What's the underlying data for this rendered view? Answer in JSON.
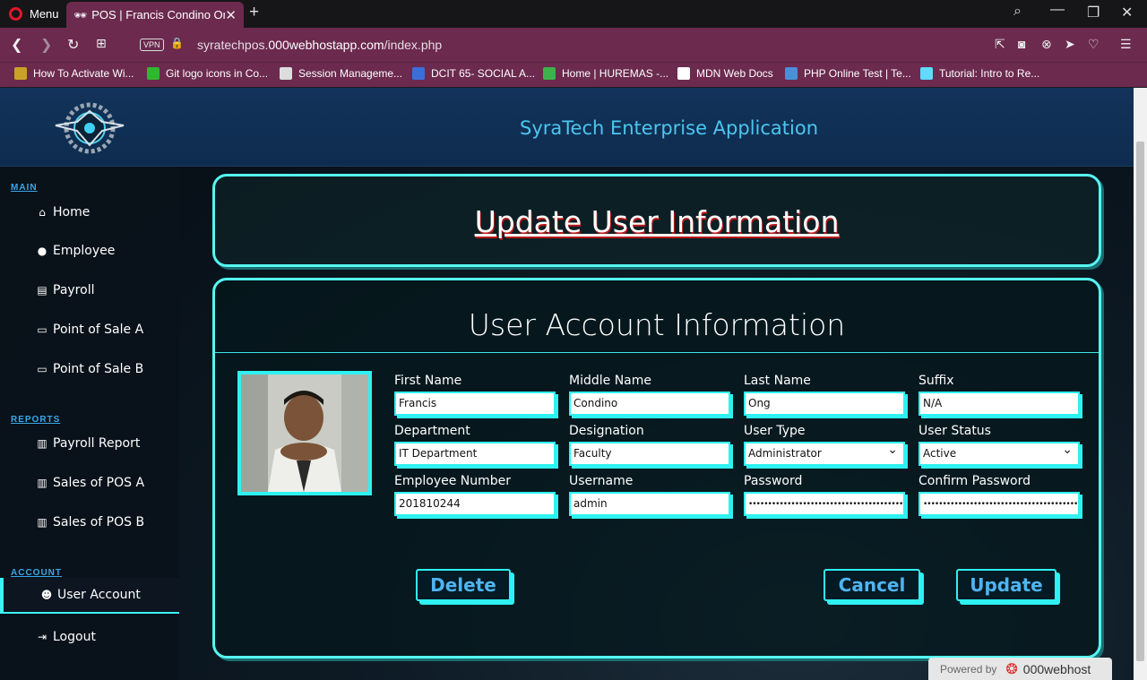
{
  "browser": {
    "menu_label": "Menu",
    "tab_title": "POS | Francis Condino Ong",
    "vpn_label": "VPN",
    "url_prefix": "syratechpos.",
    "url_domain": "000webhostapp.com",
    "url_path": "/index.php",
    "bookmarks": [
      {
        "label": "How To Activate Wi...",
        "icon": "windows-icon",
        "color": "#c9a227"
      },
      {
        "label": "Git logo icons in Co...",
        "icon": "git-icon",
        "color": "#2eb82e"
      },
      {
        "label": "Session Manageme...",
        "icon": "cookie-icon",
        "color": "#dddddd"
      },
      {
        "label": "DCIT 65- SOCIAL A...",
        "icon": "c-icon",
        "color": "#3b6fd8"
      },
      {
        "label": "Home | HUREMAS -...",
        "icon": "diamond-icon",
        "color": "#3bb34a"
      },
      {
        "label": "MDN Web Docs",
        "icon": "mdn-icon",
        "color": "#ffffff"
      },
      {
        "label": "PHP Online Test | Te...",
        "icon": "cloud-icon",
        "color": "#4a90d9"
      },
      {
        "label": "Tutorial: Intro to Re...",
        "icon": "react-icon",
        "color": "#61dafb"
      }
    ]
  },
  "app": {
    "title": "SyraTech Enterprise Application",
    "sidebar": {
      "sections": [
        {
          "label": "MAIN"
        },
        {
          "label": "REPORTS"
        },
        {
          "label": "ACCOUNT"
        }
      ],
      "items": [
        {
          "label": "Home",
          "icon": "home-icon",
          "glyph": "⌂"
        },
        {
          "label": "Employee",
          "icon": "user-circle-icon",
          "glyph": "●"
        },
        {
          "label": "Payroll",
          "icon": "file-icon",
          "glyph": "▤"
        },
        {
          "label": "Point of Sale A",
          "icon": "money-icon",
          "glyph": "▭"
        },
        {
          "label": "Point of Sale B",
          "icon": "money-icon",
          "glyph": "▭"
        },
        {
          "label": "Payroll Report",
          "icon": "files-icon",
          "glyph": "▥"
        },
        {
          "label": "Sales of POS A",
          "icon": "files-icon",
          "glyph": "▥"
        },
        {
          "label": "Sales of POS B",
          "icon": "files-icon",
          "glyph": "▥"
        },
        {
          "label": "User Account",
          "icon": "users-icon",
          "glyph": "☻",
          "active": true
        },
        {
          "label": "Logout",
          "icon": "sign-out-icon",
          "glyph": "⇥"
        }
      ]
    },
    "page_title": "Update User Information",
    "section_title": "User Account Information",
    "form": {
      "first_name": {
        "label": "First Name",
        "value": "Francis"
      },
      "middle_name": {
        "label": "Middle Name",
        "value": "Condino"
      },
      "last_name": {
        "label": "Last Name",
        "value": "Ong"
      },
      "suffix": {
        "label": "Suffix",
        "value": "N/A"
      },
      "department": {
        "label": "Department",
        "value": "IT Department"
      },
      "designation": {
        "label": "Designation",
        "value": "Faculty"
      },
      "user_type": {
        "label": "User Type",
        "value": "Administrator"
      },
      "user_status": {
        "label": "User Status",
        "value": "Active"
      },
      "employee_number": {
        "label": "Employee Number",
        "value": "201810244"
      },
      "username": {
        "label": "Username",
        "value": "admin"
      },
      "password": {
        "label": "Password",
        "value": "••••••••••••••••••••••••••••••••••••••••••••••••••"
      },
      "confirm_password": {
        "label": "Confirm Password",
        "value": "••••••••••••••••••••••••••••••••••••••••••••••••••"
      }
    },
    "buttons": {
      "delete": "Delete",
      "cancel": "Cancel",
      "update": "Update"
    },
    "badge": {
      "prefix": "Powered by",
      "brand": "000webhost"
    }
  }
}
